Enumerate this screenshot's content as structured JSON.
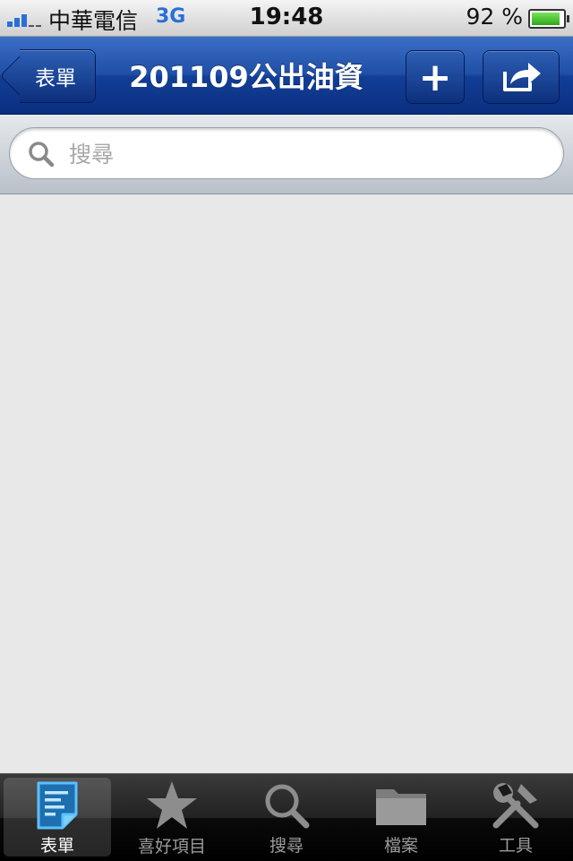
{
  "status_bar": {
    "carrier": "中華電信",
    "network": "3G",
    "time": "19:48",
    "battery_percent": "92 %",
    "battery_level": 0.92,
    "signal_bars": 3
  },
  "nav_bar": {
    "back_label": "表單",
    "title": "201109公出油資",
    "add_label": "+",
    "share_icon": "share-icon"
  },
  "search": {
    "placeholder": "搜尋",
    "value": ""
  },
  "tab_bar": {
    "selected": 0,
    "tabs": [
      {
        "label": "表單",
        "icon": "form-icon"
      },
      {
        "label": "喜好項目",
        "icon": "star-icon"
      },
      {
        "label": "搜尋",
        "icon": "search-icon"
      },
      {
        "label": "檔案",
        "icon": "folder-icon"
      },
      {
        "label": "工具",
        "icon": "tools-icon"
      }
    ]
  },
  "colors": {
    "nav_blue": "#1f4fa7",
    "content_bg": "#e8e8e8",
    "tab_selected": "#4aa8e8"
  }
}
